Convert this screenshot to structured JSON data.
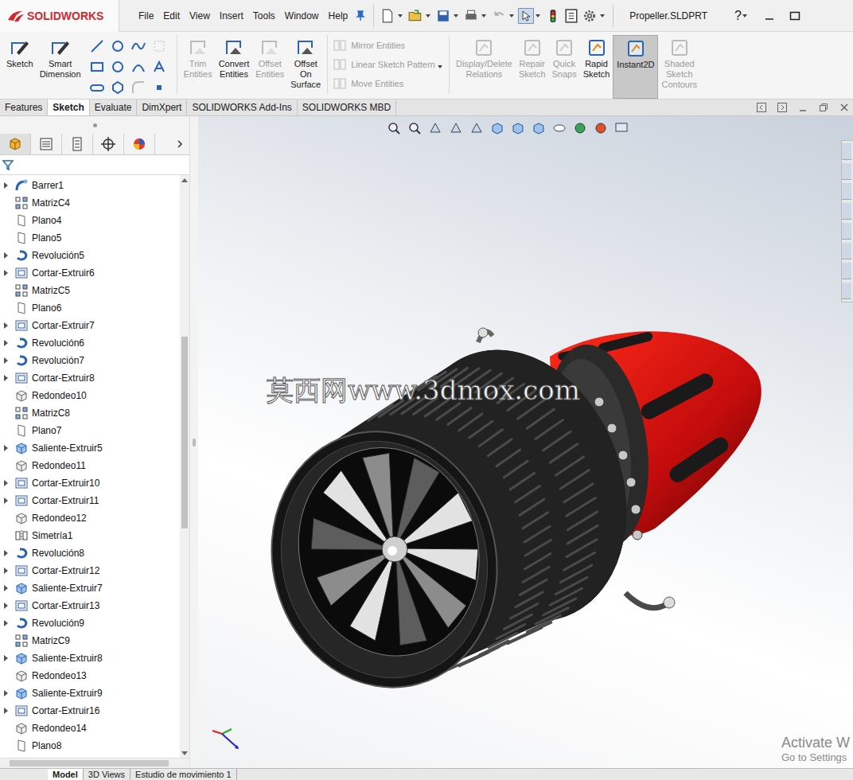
{
  "app": {
    "logo": "SOLIDWORKS",
    "title": "Propeller.SLDPRT",
    "help": "?"
  },
  "menu": [
    "File",
    "Edit",
    "View",
    "Insert",
    "Tools",
    "Window",
    "Help"
  ],
  "ribbon": {
    "lead": [
      {
        "label": "Sketch",
        "disabled": false,
        "selected": false
      },
      {
        "label": "Smart Dimension",
        "disabled": false,
        "selected": false
      }
    ],
    "middle": [
      {
        "label": "Trim Entities",
        "disabled": true,
        "selected": false
      },
      {
        "label": "Convert Entities",
        "disabled": false,
        "selected": false
      },
      {
        "label": "Offset Entities",
        "disabled": true,
        "selected": false
      },
      {
        "label": "Offset On Surface",
        "disabled": false,
        "selected": false
      }
    ],
    "stack": [
      {
        "label": "Mirror Entities",
        "disabled": true
      },
      {
        "label": "Linear Sketch Pattern",
        "disabled": true
      },
      {
        "label": "Move Entities",
        "disabled": true
      }
    ],
    "trail": [
      {
        "label": "Display/Delete Relations",
        "disabled": true,
        "selected": false
      },
      {
        "label": "Repair Sketch",
        "disabled": true,
        "selected": false
      },
      {
        "label": "Quick Snaps",
        "disabled": true,
        "selected": false
      },
      {
        "label": "Rapid Sketch",
        "disabled": false,
        "selected": false
      },
      {
        "label": "Instant2D",
        "disabled": false,
        "selected": true
      },
      {
        "label": "Shaded Sketch Contours",
        "disabled": true,
        "selected": false
      }
    ]
  },
  "command_tabs": [
    {
      "label": "Features",
      "selected": false
    },
    {
      "label": "Sketch",
      "selected": true
    },
    {
      "label": "Evaluate",
      "selected": false
    },
    {
      "label": "DimXpert",
      "selected": false
    },
    {
      "label": "SOLIDWORKS Add-Ins",
      "selected": false
    },
    {
      "label": "SOLIDWORKS MBD",
      "selected": false
    }
  ],
  "feature_tree": {
    "items": [
      {
        "label": "Barrer1",
        "kind": "sweep",
        "expandable": true
      },
      {
        "label": "MatrizC4",
        "kind": "pattern",
        "expandable": false
      },
      {
        "label": "Plano4",
        "kind": "plane",
        "expandable": false
      },
      {
        "label": "Plano5",
        "kind": "plane",
        "expandable": false
      },
      {
        "label": "Revolución5",
        "kind": "revolve",
        "expandable": true
      },
      {
        "label": "Cortar-Extruir6",
        "kind": "cut",
        "expandable": true
      },
      {
        "label": "MatrizC5",
        "kind": "pattern",
        "expandable": false
      },
      {
        "label": "Plano6",
        "kind": "plane",
        "expandable": false
      },
      {
        "label": "Cortar-Extruir7",
        "kind": "cut",
        "expandable": true
      },
      {
        "label": "Revolución6",
        "kind": "revolve",
        "expandable": true
      },
      {
        "label": "Revolución7",
        "kind": "revolve",
        "expandable": true
      },
      {
        "label": "Cortar-Extruir8",
        "kind": "cut",
        "expandable": true
      },
      {
        "label": "Redondeo10",
        "kind": "fillet",
        "expandable": false
      },
      {
        "label": "MatrizC8",
        "kind": "pattern",
        "expandable": false
      },
      {
        "label": "Plano7",
        "kind": "plane",
        "expandable": false
      },
      {
        "label": "Saliente-Extruir5",
        "kind": "boss",
        "expandable": true
      },
      {
        "label": "Redondeo11",
        "kind": "fillet",
        "expandable": false
      },
      {
        "label": "Cortar-Extruir10",
        "kind": "cut",
        "expandable": true
      },
      {
        "label": "Cortar-Extruir11",
        "kind": "cut",
        "expandable": true
      },
      {
        "label": "Redondeo12",
        "kind": "fillet",
        "expandable": false
      },
      {
        "label": "Simetría1",
        "kind": "mirror",
        "expandable": false
      },
      {
        "label": "Revolución8",
        "kind": "revolve",
        "expandable": true
      },
      {
        "label": "Cortar-Extruir12",
        "kind": "cut",
        "expandable": true
      },
      {
        "label": "Saliente-Extruir7",
        "kind": "boss",
        "expandable": true
      },
      {
        "label": "Cortar-Extruir13",
        "kind": "cut",
        "expandable": true
      },
      {
        "label": "Revolución9",
        "kind": "revolve",
        "expandable": true
      },
      {
        "label": "MatrizC9",
        "kind": "pattern",
        "expandable": false
      },
      {
        "label": "Saliente-Extruir8",
        "kind": "boss",
        "expandable": true
      },
      {
        "label": "Redondeo13",
        "kind": "fillet",
        "expandable": false
      },
      {
        "label": "Saliente-Extruir9",
        "kind": "boss",
        "expandable": true
      },
      {
        "label": "Cortar-Extruir16",
        "kind": "cut",
        "expandable": true
      },
      {
        "label": "Redondeo14",
        "kind": "fillet",
        "expandable": false
      },
      {
        "label": "Plano8",
        "kind": "plane",
        "expandable": false
      }
    ],
    "scroll": {
      "position": 0.27,
      "size": 0.34
    }
  },
  "viewport": {
    "watermark": "莫西网www.3dmox.com",
    "activation": [
      "Activate W",
      "Go to Settings"
    ]
  },
  "bottom_tabs": [
    {
      "label": "Model",
      "selected": true
    },
    {
      "label": "3D Views",
      "selected": false
    },
    {
      "label": "Estudio de movimiento 1",
      "selected": false
    }
  ]
}
